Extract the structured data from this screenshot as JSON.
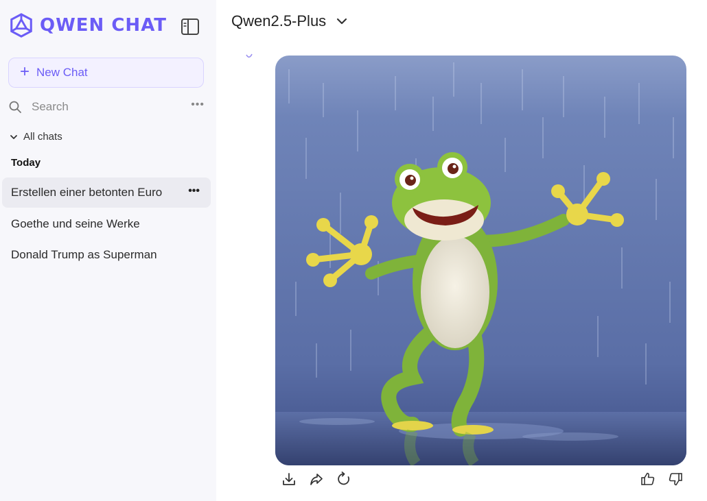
{
  "brand": {
    "name": "QWEN CHAT",
    "accent": "#6b5cf6"
  },
  "sidebar": {
    "toggle_icon": "sidebar-toggle-icon",
    "new_chat_label": "New Chat",
    "search_placeholder": "Search",
    "all_chats_label": "All chats",
    "group_title": "Today",
    "chats": [
      {
        "label": "Erstellen einer betonten Euro",
        "active": true
      },
      {
        "label": "Goethe und seine Werke",
        "active": false
      },
      {
        "label": "Donald Trump as Superman",
        "active": false
      }
    ]
  },
  "main": {
    "model_label": "Qwen2.5-Plus",
    "image_alt": "Cartoon frog dancing in the rain",
    "actions_left": [
      "download-icon",
      "share-icon",
      "regenerate-icon"
    ],
    "actions_right": [
      "thumbs-up-icon",
      "thumbs-down-icon"
    ]
  }
}
